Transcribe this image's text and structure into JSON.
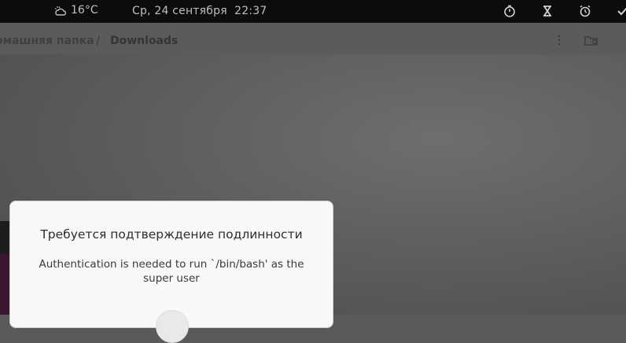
{
  "topbar": {
    "weather_temp": "16°C",
    "weather_icon": "partly-cloudy-icon",
    "datetime": "Ср, 24 сентября  22:37",
    "indicators": [
      "timer-icon",
      "hourglass-icon",
      "alarm-clock-icon",
      "check-icon"
    ]
  },
  "file_manager": {
    "breadcrumb_home": "омашняя папка",
    "breadcrumb_separator": "/",
    "breadcrumb_current": "Downloads"
  },
  "auth_dialog": {
    "title": "Требуется подтверждение подлинности",
    "message": "Authentication is needed to run `/bin/bash' as the super user"
  },
  "colors": {
    "topbar_bg": "#0c0c0c",
    "overlay": "#5a5a5a",
    "dialog_bg": "#f8f8f8"
  }
}
